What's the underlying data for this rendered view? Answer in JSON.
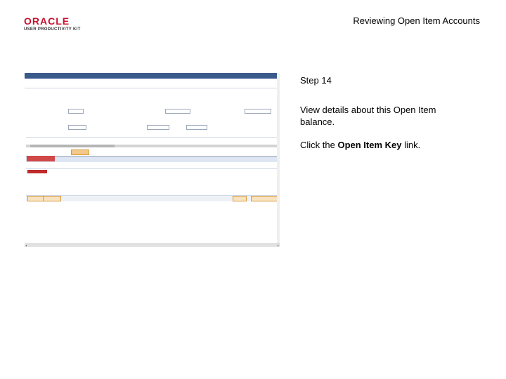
{
  "logo": {
    "brand": "ORACLE",
    "product": "USER PRODUCTIVITY KIT"
  },
  "header": {
    "title": "Reviewing Open Item Accounts"
  },
  "step": {
    "label": "Step 14",
    "description": "View details about this Open Item balance.",
    "instruction_prefix": "Click the ",
    "instruction_target": "Open Item Key",
    "instruction_suffix": " link."
  }
}
